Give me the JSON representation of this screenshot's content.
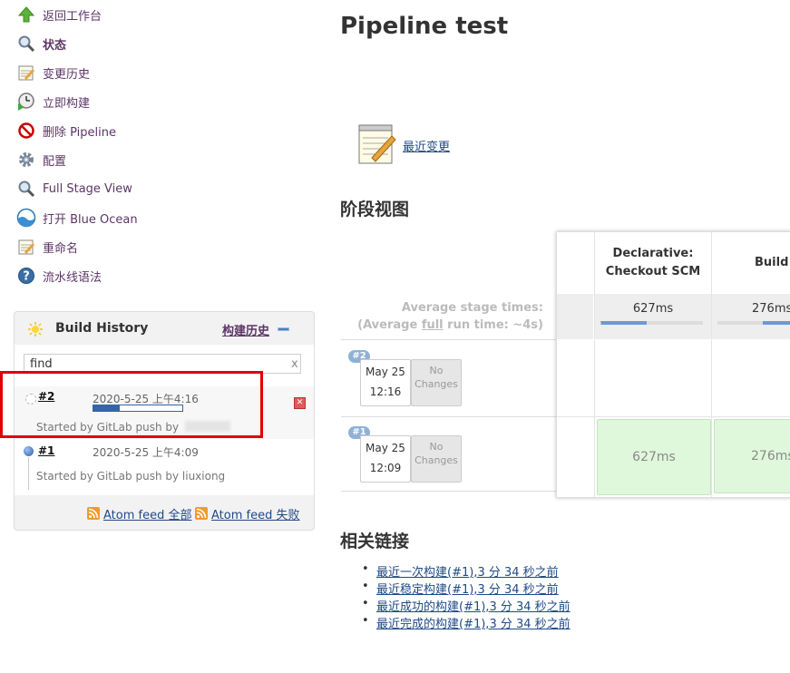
{
  "sidebar": {
    "items": [
      {
        "label": "返回工作台",
        "icon": "arrow-up-icon"
      },
      {
        "label": "状态",
        "icon": "magnifier-icon"
      },
      {
        "label": "变更历史",
        "icon": "notepad-icon"
      },
      {
        "label": "立即构建",
        "icon": "clock-play-icon"
      },
      {
        "label": "删除 Pipeline",
        "icon": "no-entry-icon"
      },
      {
        "label": "配置",
        "icon": "gear-icon"
      },
      {
        "label": "Full Stage View",
        "icon": "magnifier-icon"
      },
      {
        "label": "打开 Blue Ocean",
        "icon": "blue-ocean-icon"
      },
      {
        "label": "重命名",
        "icon": "notepad-icon"
      },
      {
        "label": "流水线语法",
        "icon": "help-icon"
      }
    ]
  },
  "build_history": {
    "title": "Build History",
    "link": "构建历史",
    "search_value": "find",
    "search_clear": "x",
    "builds": [
      {
        "number": "#2",
        "date": "2020-5-25 上午4:16",
        "note": "Started by GitLab push by",
        "progress": 0.3
      },
      {
        "number": "#1",
        "date": "2020-5-25 上午4:09",
        "note": "Started by GitLab push by liuxiong"
      }
    ],
    "feeds": [
      "Atom feed 全部",
      "Atom feed 失败"
    ]
  },
  "main": {
    "title": "Pipeline test",
    "recent_changes": "最近变更",
    "stage_view_title": "阶段视图",
    "related_title": "相关链接"
  },
  "stage_view": {
    "avg_stage_times": "Average stage times:",
    "avg_run_prefix": "(Average ",
    "avg_run_link": "full",
    "avg_run_suffix": " run time: ~4s)",
    "stages": [
      {
        "name_line1": "Declarative:",
        "name_line2": "Checkout SCM",
        "avg": "627ms",
        "bar_fill": 0.45
      },
      {
        "name_line1": "Build",
        "name_line2": "",
        "avg": "276ms",
        "bar_fill": 0.35
      }
    ],
    "runs": [
      {
        "badge": "#2",
        "date": "May 25",
        "time": "12:16",
        "changes_line1": "No",
        "changes_line2": "Changes",
        "cells": [
          "",
          ""
        ]
      },
      {
        "badge": "#1",
        "date": "May 25",
        "time": "12:09",
        "changes_line1": "No",
        "changes_line2": "Changes",
        "cells": [
          "627ms",
          "276ms"
        ]
      }
    ]
  },
  "related_links": [
    {
      "text": "最近一次构建(#1),3 分 34 秒之前"
    },
    {
      "text": "最近稳定构建(#1),3 分 34 秒之前"
    },
    {
      "text": "最近成功的构建(#1),3 分 34 秒之前"
    },
    {
      "text": "最近完成的构建(#1),3 分 34 秒之前"
    }
  ],
  "colors": {
    "link": "#204a87",
    "sidebar_link": "#5c3566",
    "highlight_box": "#e00000",
    "success_cell": "#dff7da",
    "progress": "#3465a4"
  }
}
